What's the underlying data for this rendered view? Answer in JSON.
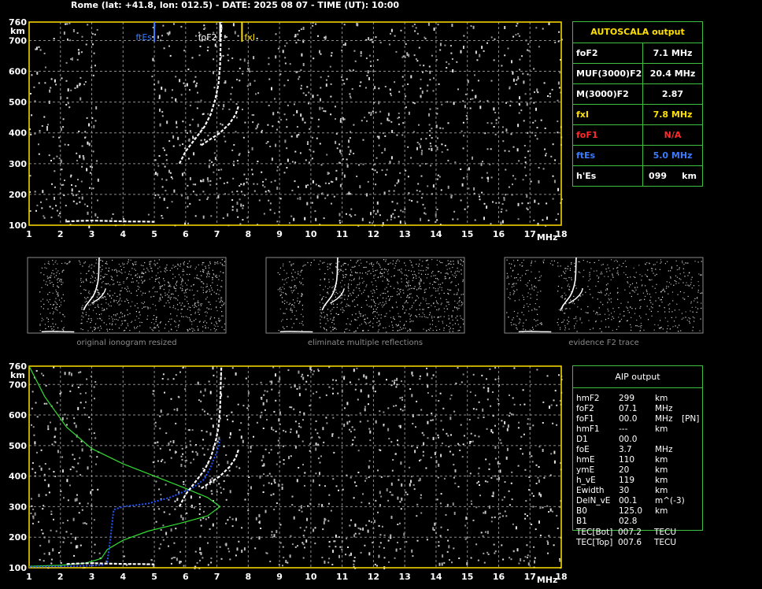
{
  "header": {
    "title": "Rome (lat: +41.8, lon: 012.5) - DATE: 2025 08 07 - TIME (UT): 10:00"
  },
  "colors": {
    "grid": "#8c8c8c",
    "frame": "#ffe000",
    "trace": "#ffffff",
    "profile": "#33dd33",
    "true_height": "#2255ff",
    "foF2_label": "#ffffff",
    "fxI_label": "#ffe000",
    "ftEs_label": "#3a7bff",
    "table_border": "#3fbf3f",
    "na_red": "#ff2a2a"
  },
  "autoscala": {
    "title": "AUTOSCALA output",
    "rows": [
      {
        "label": "foF2",
        "value": "7.1 MHz",
        "color": "#ffffff"
      },
      {
        "label": "MUF(3000)F2",
        "value": "20.4 MHz",
        "color": "#ffffff"
      },
      {
        "label": "M(3000)F2",
        "value": "2.87",
        "color": "#ffffff"
      },
      {
        "label": "fxI",
        "value": "7.8 MHz",
        "color": "#ffe000"
      },
      {
        "label": "foF1",
        "value": "N/A",
        "color": "#ff2a2a"
      },
      {
        "label": "ftEs",
        "value": "5.0 MHz",
        "color": "#3a7bff"
      },
      {
        "label": "h'Es",
        "value": "099     km",
        "color": "#ffffff"
      }
    ]
  },
  "aip": {
    "title": "AIP output",
    "rows": [
      {
        "name": "hmF2",
        "value": "299",
        "unit": "km",
        "extra": ""
      },
      {
        "name": "foF2",
        "value": "07.1",
        "unit": "MHz",
        "extra": ""
      },
      {
        "name": "foF1",
        "value": "00.0",
        "unit": "MHz",
        "extra": "[PN]"
      },
      {
        "name": "hmF1",
        "value": "---",
        "unit": "km",
        "extra": ""
      },
      {
        "name": "D1",
        "value": "00.0",
        "unit": "",
        "extra": ""
      },
      {
        "name": "foE",
        "value": "3.7",
        "unit": "MHz",
        "extra": ""
      },
      {
        "name": "hmE",
        "value": "110",
        "unit": "km",
        "extra": ""
      },
      {
        "name": "ymE",
        "value": "20",
        "unit": "km",
        "extra": ""
      },
      {
        "name": "h_vE",
        "value": "119",
        "unit": "km",
        "extra": ""
      },
      {
        "name": "Ewidth",
        "value": "30",
        "unit": "km",
        "extra": ""
      },
      {
        "name": "DelN_vE",
        "value": "00.1",
        "unit": "m^(-3)",
        "extra": ""
      },
      {
        "name": "B0",
        "value": "125.0",
        "unit": "km",
        "extra": ""
      },
      {
        "name": "B1",
        "value": "02.8",
        "unit": "",
        "extra": ""
      }
    ],
    "tail": [
      {
        "name": "TEC[Bot]",
        "value": "007.2",
        "unit": "TECU"
      },
      {
        "name": "TEC[Top]",
        "value": "007.6",
        "unit": "TECU"
      }
    ]
  },
  "thumbnails": [
    {
      "caption": "original ionogram resized"
    },
    {
      "caption": "eliminate multiple reflections"
    },
    {
      "caption": "evidence F2 trace"
    }
  ],
  "chart_data": [
    {
      "type": "scatter",
      "panel": "autoscala-ionogram",
      "x_axis": {
        "range": [
          1,
          18
        ],
        "ticks": [
          1,
          2,
          3,
          4,
          5,
          6,
          7,
          8,
          9,
          10,
          11,
          12,
          13,
          14,
          15,
          16,
          17,
          18
        ],
        "label": "MHz"
      },
      "y_axis": {
        "range": [
          100,
          760
        ],
        "ticks": [
          100,
          200,
          300,
          400,
          500,
          600,
          700,
          760
        ],
        "label": "km"
      },
      "grid": true,
      "markers": [
        {
          "name": "ftEs",
          "x": 5.0,
          "color": "#3a7bff"
        },
        {
          "name": "foF2",
          "x": 7.1,
          "color": "#ffffff"
        },
        {
          "name": "fxI",
          "x": 7.8,
          "color": "#ffe000"
        }
      ],
      "series": [
        {
          "type": "trace",
          "color": "#ffffff",
          "points": [
            [
              5.8,
              300
            ],
            [
              6.0,
              340
            ],
            [
              6.3,
              380
            ],
            [
              6.6,
              420
            ],
            [
              6.8,
              460
            ],
            [
              6.95,
              510
            ],
            [
              7.05,
              560
            ],
            [
              7.1,
              620
            ],
            [
              7.12,
              700
            ],
            [
              7.14,
              760
            ]
          ]
        },
        {
          "type": "trace",
          "color": "#ffffff",
          "points": [
            [
              6.5,
              360
            ],
            [
              6.8,
              380
            ],
            [
              7.1,
              400
            ],
            [
              7.4,
              430
            ],
            [
              7.6,
              460
            ],
            [
              7.7,
              490
            ]
          ]
        },
        {
          "type": "trace",
          "color": "#ffffff",
          "points": [
            [
              2.2,
              112
            ],
            [
              2.6,
              114
            ],
            [
              3.0,
              115
            ],
            [
              3.4,
              114
            ],
            [
              3.8,
              113
            ],
            [
              4.2,
              112
            ],
            [
              4.6,
              112
            ],
            [
              5.0,
              111
            ]
          ]
        }
      ]
    },
    {
      "type": "line",
      "panel": "aip-ionogram",
      "x_axis": {
        "range": [
          1,
          18
        ],
        "ticks": [
          1,
          2,
          3,
          4,
          5,
          6,
          7,
          8,
          9,
          10,
          11,
          12,
          13,
          14,
          15,
          16,
          17,
          18
        ],
        "label": "MHz"
      },
      "y_axis": {
        "range": [
          100,
          760
        ],
        "ticks": [
          100,
          200,
          300,
          400,
          500,
          600,
          700,
          760
        ],
        "label": "km"
      },
      "grid": true,
      "series": [
        {
          "type": "profile",
          "color": "#33dd33",
          "points": [
            [
              1.0,
              760
            ],
            [
              1.5,
              660
            ],
            [
              2.2,
              560
            ],
            [
              3.0,
              490
            ],
            [
              4.0,
              440
            ],
            [
              5.0,
              400
            ],
            [
              6.0,
              360
            ],
            [
              6.7,
              330
            ],
            [
              7.1,
              300
            ],
            [
              6.7,
              270
            ],
            [
              5.8,
              245
            ],
            [
              4.8,
              220
            ],
            [
              4.0,
              190
            ],
            [
              3.5,
              160
            ],
            [
              3.3,
              130
            ],
            [
              2.8,
              115
            ],
            [
              2.0,
              108
            ],
            [
              1.0,
              105
            ]
          ]
        },
        {
          "type": "true-height",
          "color": "#2255ff",
          "points": [
            [
              1.0,
              103
            ],
            [
              2.0,
              104
            ],
            [
              3.0,
              107
            ],
            [
              3.4,
              110
            ],
            [
              3.5,
              120
            ],
            [
              3.6,
              200
            ],
            [
              3.7,
              290
            ],
            [
              4.0,
              300
            ],
            [
              4.8,
              310
            ],
            [
              5.5,
              330
            ],
            [
              6.2,
              360
            ],
            [
              6.6,
              390
            ],
            [
              6.8,
              430
            ],
            [
              7.0,
              480
            ],
            [
              7.1,
              520
            ]
          ]
        },
        {
          "type": "trace",
          "color": "#ffffff",
          "points": [
            [
              5.8,
              300
            ],
            [
              6.0,
              340
            ],
            [
              6.3,
              380
            ],
            [
              6.6,
              420
            ],
            [
              6.8,
              460
            ],
            [
              6.95,
              510
            ],
            [
              7.05,
              560
            ],
            [
              7.1,
              620
            ],
            [
              7.12,
              700
            ],
            [
              7.14,
              760
            ]
          ]
        },
        {
          "type": "trace",
          "color": "#ffffff",
          "points": [
            [
              6.5,
              360
            ],
            [
              6.8,
              380
            ],
            [
              7.1,
              400
            ],
            [
              7.4,
              430
            ],
            [
              7.6,
              460
            ],
            [
              7.7,
              490
            ]
          ]
        },
        {
          "type": "trace",
          "color": "#ffffff",
          "points": [
            [
              2.2,
              112
            ],
            [
              2.6,
              114
            ],
            [
              3.0,
              115
            ],
            [
              3.4,
              114
            ],
            [
              3.8,
              113
            ],
            [
              4.2,
              112
            ],
            [
              4.6,
              112
            ],
            [
              5.0,
              111
            ]
          ]
        }
      ]
    }
  ]
}
